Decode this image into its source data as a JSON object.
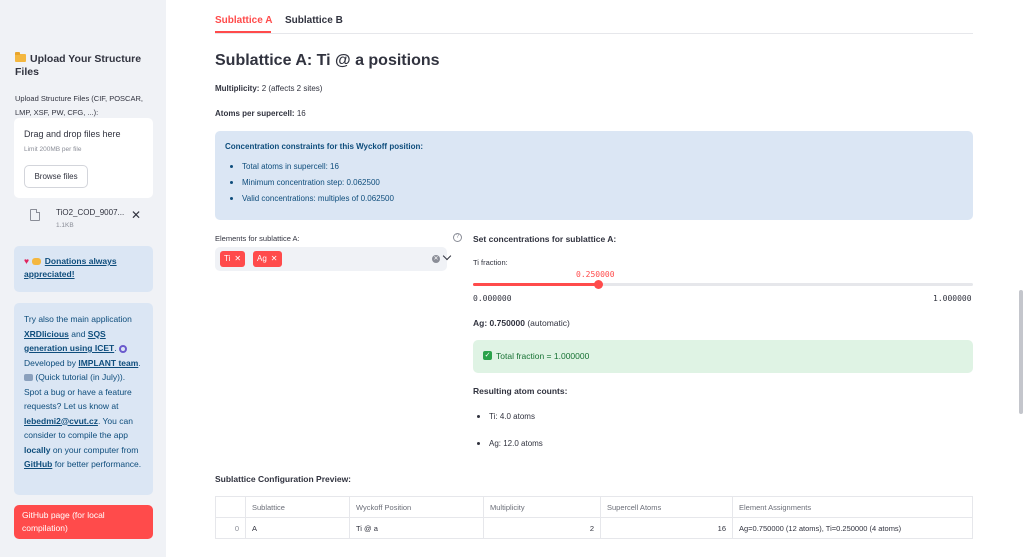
{
  "sidebar": {
    "title": "Upload Your Structure Files",
    "upload_label": "Upload Structure Files (CIF, POSCAR, LMP, XSF, PW, CFG, ...):",
    "dropzone_title": "Drag and drop files here",
    "dropzone_limit": "Limit 200MB per file",
    "browse_label": "Browse files",
    "file_name": "TiO2_COD_9007...",
    "file_size": "1.1KB",
    "donate_link": "Donations always appreciated!",
    "info": {
      "t1": "Try also the main application ",
      "l1": "XRDlicious",
      "t2": " and ",
      "l2": "SQS generation using ICET",
      "t3": ". ",
      "t4": " Developed by ",
      "l3": "IMPLANT team",
      "t5": ". ",
      "t6": " (Quick tutorial (in July)). Spot a bug or have a feature requests? Let us know at ",
      "l4": "lebedmi2@cvut.cz",
      "t7": ". You can consider to compile the app ",
      "b1": "locally",
      "t8": " on your computer from ",
      "l5": "GitHub",
      "t9": " for better performance."
    },
    "github_button": "GitHub page (for local compilation)"
  },
  "tabs": [
    {
      "label": "Sublattice A",
      "active": true
    },
    {
      "label": "Sublattice B",
      "active": false
    }
  ],
  "main": {
    "title": "Sublattice A: Ti @ a positions",
    "multiplicity_label": "Multiplicity:",
    "multiplicity_value": "2 (affects 2 sites)",
    "atoms_label": "Atoms per supercell:",
    "atoms_value": "16",
    "constraints_title": "Concentration constraints for this Wyckoff position:",
    "constraints": [
      "Total atoms in supercell: 16",
      "Minimum concentration step: 0.062500",
      "Valid concentrations: multiples of 0.062500"
    ],
    "elements_label": "Elements for sublattice A:",
    "elements": [
      "Ti",
      "Ag"
    ],
    "conc_title": "Set concentrations for sublattice A:",
    "slider": {
      "label": "Ti fraction:",
      "value": 0.25,
      "value_text": "0.250000",
      "min_text": "0.000000",
      "max_text": "1.000000",
      "min": 0,
      "max": 1
    },
    "ag_label": "Ag: 0.750000",
    "ag_suffix": " (automatic)",
    "total_fraction": "Total fraction = 1.000000",
    "result_title": "Resulting atom counts:",
    "results": [
      "Ti: 4.0 atoms",
      "Ag: 12.0 atoms"
    ],
    "preview_title": "Sublattice Configuration Preview:",
    "table": {
      "headers": [
        "",
        "Sublattice",
        "Wyckoff Position",
        "Multiplicity",
        "Supercell Atoms",
        "Element Assignments"
      ],
      "rows": [
        [
          "0",
          "A",
          "Ti @ a",
          "2",
          "16",
          "Ag=0.750000 (12 atoms), Ti=0.250000 (4 atoms)"
        ]
      ]
    }
  },
  "colors": {
    "accent": "#ff4b4b",
    "info_bg": "#dbe6f4",
    "success_bg": "#dff3e4"
  }
}
